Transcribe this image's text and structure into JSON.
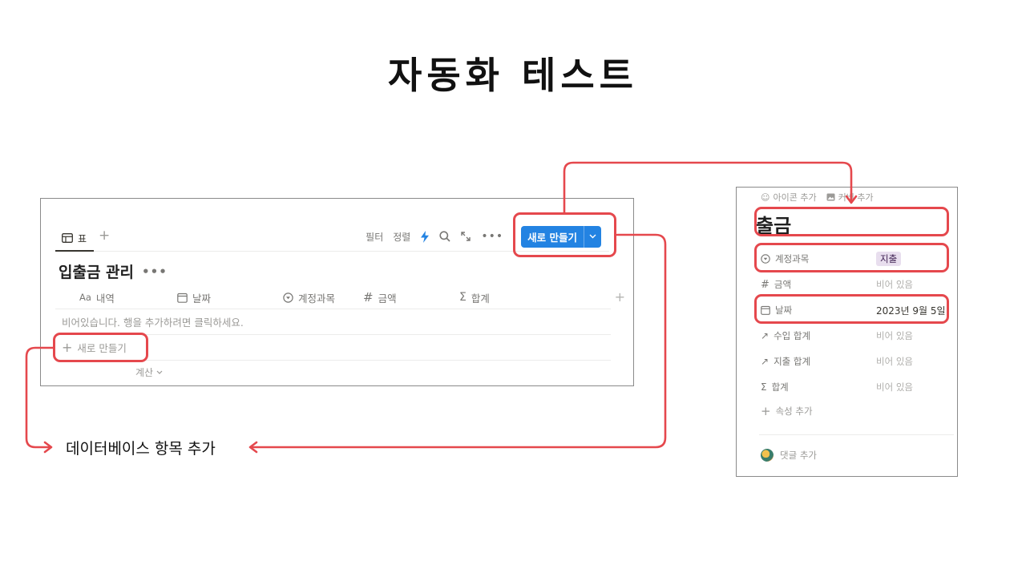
{
  "slide": {
    "title": "자동화 테스트",
    "caption": "데이터베이스 항목 추가"
  },
  "database": {
    "tab_label": "표",
    "toolbar": {
      "filter": "필터",
      "sort": "정렬",
      "new_button": "새로 만들기"
    },
    "title": "입출금 관리",
    "columns": [
      {
        "label": "내역",
        "icon": "Aa"
      },
      {
        "label": "날짜",
        "icon": "calendar-icon"
      },
      {
        "label": "계정과목",
        "icon": "select-icon"
      },
      {
        "label": "금액",
        "icon": "#"
      },
      {
        "label": "합계",
        "icon": "Σ"
      }
    ],
    "empty_text": "비어있습니다. 행을 추가하려면 클릭하세요.",
    "new_row_label": "새로 만들기",
    "calc_label": "계산"
  },
  "page": {
    "add_icon": "아이콘 추가",
    "add_cover": "커버 추가",
    "title": "출금",
    "properties": [
      {
        "name": "계정과목",
        "icon": "select-icon",
        "value": "지출",
        "type": "tag"
      },
      {
        "name": "금액",
        "icon": "#",
        "value": "비어 있음",
        "type": "empty"
      },
      {
        "name": "날짜",
        "icon": "calendar-icon",
        "value": "2023년 9월 5일",
        "type": "value"
      },
      {
        "name": "수입 합계",
        "icon": "rollup-arrow-icon",
        "value": "비어 있음",
        "type": "empty"
      },
      {
        "name": "지출 합계",
        "icon": "rollup-arrow-icon",
        "value": "비어 있음",
        "type": "empty"
      },
      {
        "name": "합계",
        "icon": "Σ",
        "value": "비어 있음",
        "type": "empty"
      }
    ],
    "add_property": "속성 추가",
    "add_comment": "댓글 추가"
  },
  "colors": {
    "highlight": "#e5484d",
    "button": "#2383e2",
    "tag_bg": "#e8deee"
  }
}
